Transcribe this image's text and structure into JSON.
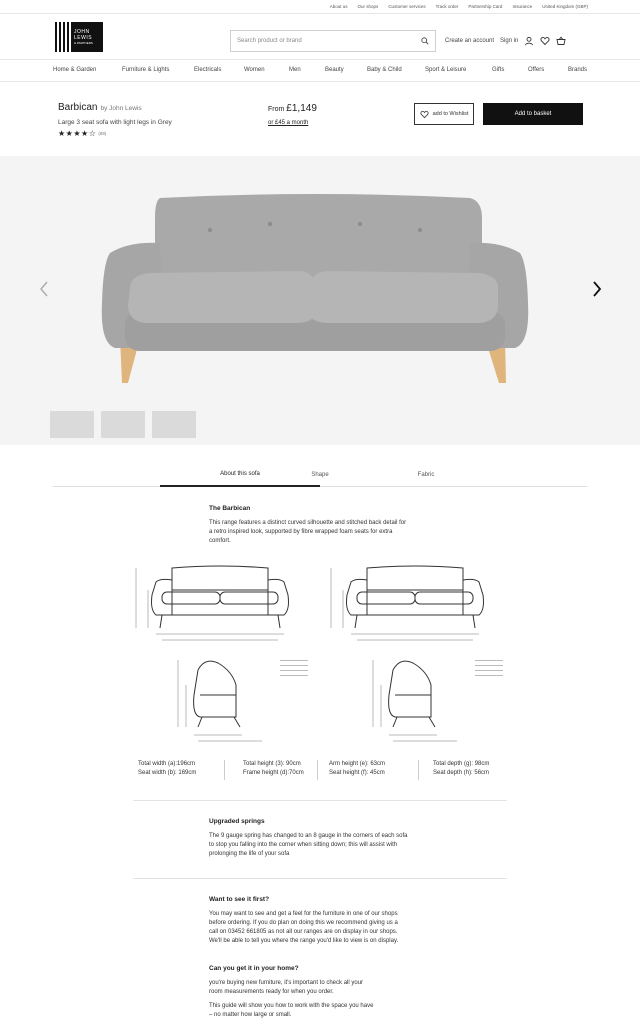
{
  "utility": [
    "About us",
    "Our shops",
    "Customer services",
    "Track order",
    "Partnership Card",
    "Insurance",
    "United Kingdom (GBP)"
  ],
  "logo": {
    "line1": "JOHN",
    "line2": "LEWIS",
    "line3": "& PARTNERS"
  },
  "search": {
    "placeholder": "Search product or brand"
  },
  "header": {
    "account": "Create an account",
    "signin": "Sign in"
  },
  "nav": [
    "Home & Garden",
    "Furniture & Lights",
    "Electricals",
    "Women",
    "Men",
    "Beauty",
    "Baby & Child",
    "Sport & Leisure",
    "Gifts",
    "Offers",
    "Brands"
  ],
  "product": {
    "name": "Barbican",
    "by": "by John Lewis",
    "subtitle": "Large 3 seat sofa with light legs in Grey",
    "stars": "★★★★☆",
    "rating_value": 4,
    "review_count": "(89)",
    "price_prefix": "From",
    "price": "£1,149",
    "monthly": "or £45 a month",
    "wishlist": "add to Wishlist",
    "basket": "Add to basket"
  },
  "tabs": [
    "About this sofa",
    "Shape",
    "Fabric"
  ],
  "about": {
    "title": "The Barbican",
    "text1": "This range features a distinct curved silhouette and stitched back detail for",
    "text2": "a retro inspired look, supported by fibre wrapped foam seats for extra",
    "text3": "comfort."
  },
  "dimensions": {
    "c1a": "Total width (a):196cm",
    "c1b": "Seat width (b): 169cm",
    "c2a": "Total height (3): 90cm",
    "c2b": "Frame height (d):70cm",
    "c3a": "Arm height (e): 63cm",
    "c3b": "Seat height (f): 45cm",
    "c4a": "Total depth (g): 98cm",
    "c4b": "Seat depth (h): 56cm"
  },
  "springs": {
    "title": "Upgraded springs",
    "l1": "The 9 gauge spring has changed to an 8 gauge in the corners of each sofa",
    "l2": "to stop you falling into the corner when sitting down; this will assist with",
    "l3": "prolonging the life of your sofa"
  },
  "see": {
    "title": "Want to see it first?",
    "l1": "You may want to see and get a feel for the furniture in one of our shops",
    "l2": "before ordering. If you do plan on doing this we recommend giving us a",
    "l3": "call on 03452 661805 as not all our ranges are on display in our shops.",
    "l4": "We'll be able to tell you where the range you'd like to view is on display."
  },
  "home": {
    "title": "Can you get it in your home?",
    "l1": " you're buying new furniture, it's important to check all your",
    "l2": "room measurements ready for when you order.",
    "l3": "This guide will show you how to work with the space you have",
    "l4": "– no matter how large or small."
  }
}
